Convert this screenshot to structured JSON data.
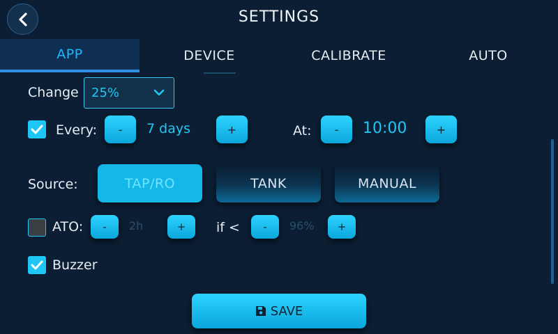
{
  "header": {
    "title": "SETTINGS"
  },
  "tabs": [
    {
      "label": "APP",
      "active": true
    },
    {
      "label": "DEVICE",
      "active": false
    },
    {
      "label": "CALIBRATE",
      "active": false
    },
    {
      "label": "AUTO",
      "active": false
    }
  ],
  "change": {
    "label": "Change",
    "selected": "25%"
  },
  "every": {
    "checked": true,
    "label": "Every:",
    "value": "7 days",
    "minus": "-",
    "plus": "+"
  },
  "at": {
    "label": "At:",
    "value": "10:00",
    "minus": "-",
    "plus": "+"
  },
  "source": {
    "label": "Source:",
    "options": [
      "TAP/RO",
      "TANK",
      "MANUAL"
    ],
    "selected": "TAP/RO"
  },
  "ato": {
    "checked": false,
    "label": "ATO:",
    "value": "2h",
    "if_label": "if <",
    "threshold": "96%",
    "minus": "-",
    "plus": "+"
  },
  "buzzer": {
    "checked": true,
    "label": "Buzzer"
  },
  "save": {
    "label": "SAVE"
  },
  "colors": {
    "background": "#0c1e33",
    "accent": "#1ec6f5",
    "active_tab_text": "#1fb7ff"
  },
  "icons": [
    "chevron-left-icon",
    "chevron-down-icon",
    "checkmark-icon",
    "floppy-disk-icon"
  ]
}
